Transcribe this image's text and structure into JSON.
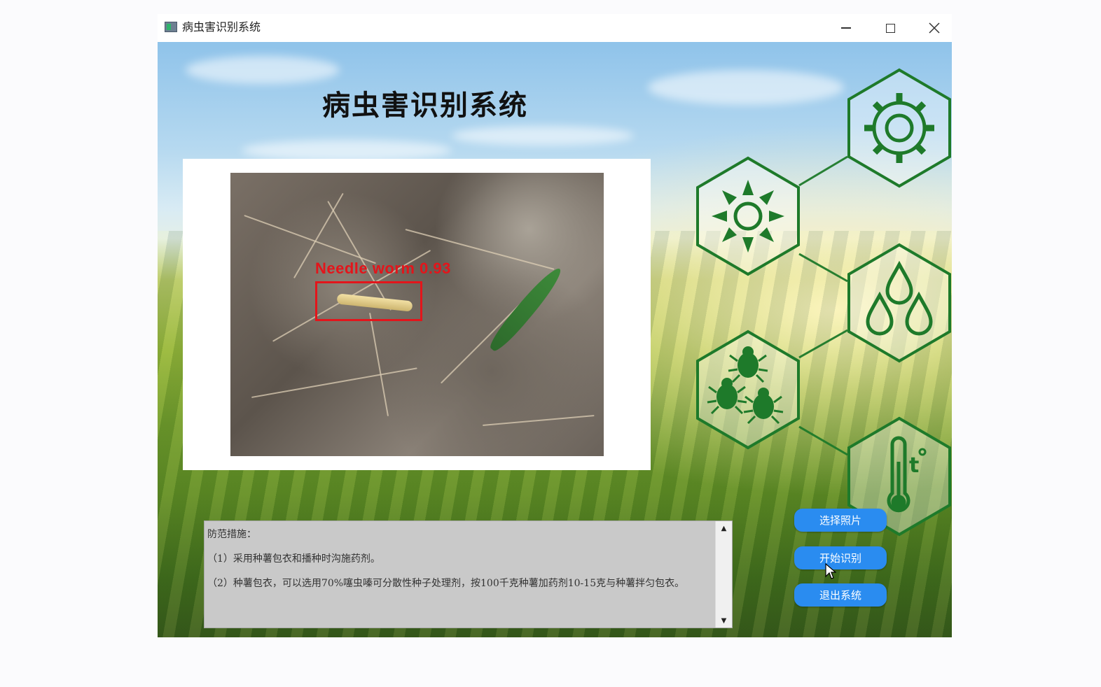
{
  "window": {
    "title": "病虫害识别系统",
    "controls": {
      "minimize": "minimize",
      "maximize": "maximize",
      "close": "close"
    }
  },
  "main": {
    "title": "病虫害识别系统"
  },
  "detection": {
    "label": "Needle worm 0.93",
    "color": "#e3151b"
  },
  "measures": {
    "heading": "防范措施：",
    "items": [
      "（1）采用种薯包衣和播种时沟施药剂。",
      "（2）种薯包衣，可以选用70%噻虫嗪可分散性种子处理剂，按100千克种薯加药剂10-15克与种薯拌匀包衣。"
    ]
  },
  "buttons": {
    "select_photo": "选择照片",
    "start_recognition": "开始识别",
    "exit_system": "退出系统"
  },
  "hex_icons": [
    "gear-icon",
    "sun-icon",
    "water-drops-icon",
    "bugs-icon",
    "thermometer-icon"
  ],
  "colors": {
    "accent": "#2a8cf0",
    "hex_stroke": "#1e7a2a",
    "detection_box": "#e3151b"
  }
}
